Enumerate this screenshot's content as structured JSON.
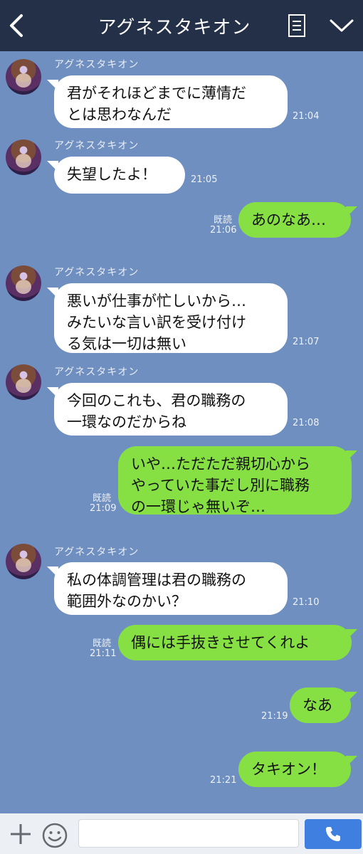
{
  "header": {
    "title": "アグネスタキオン",
    "icons": {
      "back": "chevron-left-icon",
      "memo": "note-icon",
      "menu": "chevron-down-icon"
    }
  },
  "messages": [
    {
      "sender": "アグネスタキオン",
      "text": "君がそれほどまでに薄情だ\nとは思わなんだ",
      "time": "21:04"
    },
    {
      "sender": "アグネスタキオン",
      "text": "失望したよ！",
      "time": "21:05"
    },
    {
      "read": "既読",
      "text": "あのなあ…",
      "time": "21:06"
    },
    {
      "sender": "アグネスタキオン",
      "text": "悪いが仕事が忙しいから…\nみたいな言い訳を受け付け\nる気は一切は無い",
      "time": "21:07"
    },
    {
      "sender": "アグネスタキオン",
      "text": "今回のこれも、君の職務の\n一環なのだからね",
      "time": "21:08"
    },
    {
      "read": "既読",
      "text": "いや…ただただ親切心から\nやっていた事だし別に職務\nの一環じゃ無いぞ…",
      "time": "21:09"
    },
    {
      "sender": "アグネスタキオン",
      "text": "私の体調管理は君の職務の\n範囲外なのかい？",
      "time": "21:10"
    },
    {
      "read": "既読",
      "text": "偶には手抜きさせてくれよ",
      "time": "21:11"
    },
    {
      "text": "なあ",
      "time": "21:19"
    },
    {
      "text": "タキオン！",
      "time": "21:21"
    }
  ],
  "footer": {
    "input_placeholder": "",
    "icons": {
      "add": "plus-icon",
      "emoji": "smiley-icon",
      "call": "phone-icon"
    },
    "call_color": "#3f7fe0"
  },
  "colors": {
    "background": "#6f8fc0",
    "header": "#243047",
    "sent_bubble": "#86e043",
    "received_bubble": "#ffffff"
  }
}
